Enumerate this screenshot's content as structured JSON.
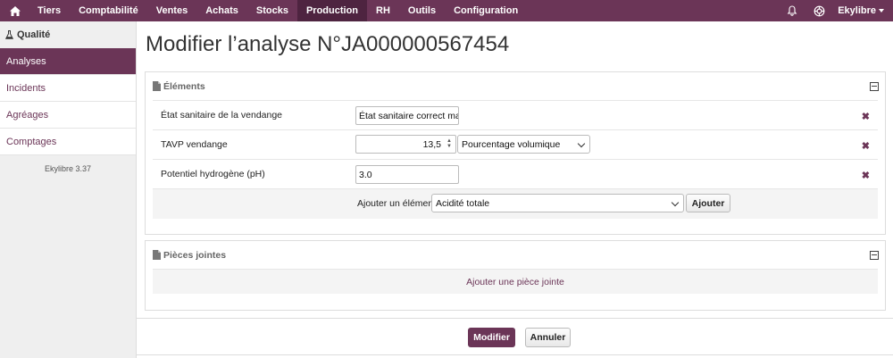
{
  "nav": {
    "home_icon": "home-icon",
    "items": [
      "Tiers",
      "Comptabilité",
      "Ventes",
      "Achats",
      "Stocks",
      "Production",
      "RH",
      "Outils",
      "Configuration"
    ],
    "active": "Production",
    "user": "Ekylibre"
  },
  "sidebar": {
    "section_title": "Qualité",
    "items": [
      {
        "label": "Analyses",
        "active": true
      },
      {
        "label": "Incidents"
      },
      {
        "label": "Agréages"
      },
      {
        "label": "Comptages"
      }
    ],
    "version": "Ekylibre 3.37"
  },
  "page_title": "Modifier l’analyse N°JA000000567454",
  "elements_panel": {
    "title": "Éléments",
    "rows": [
      {
        "label": "État sanitaire de la vendange",
        "value": "État sanitaire correct mais"
      },
      {
        "label": "TAVP vendange",
        "value": "13,5",
        "unit": "Pourcentage volumique"
      },
      {
        "label": "Potentiel hydrogène (pH)",
        "value": "3.0"
      }
    ],
    "add_label": "Ajouter un élément",
    "add_select": "Acidité totale",
    "add_button": "Ajouter"
  },
  "attachments_panel": {
    "title": "Pièces jointes",
    "add_link": "Ajouter une pièce jointe"
  },
  "actions": {
    "submit": "Modifier",
    "cancel": "Annuler"
  },
  "colors": {
    "brand": "#6b3557",
    "brand_dark": "#4e2440"
  }
}
